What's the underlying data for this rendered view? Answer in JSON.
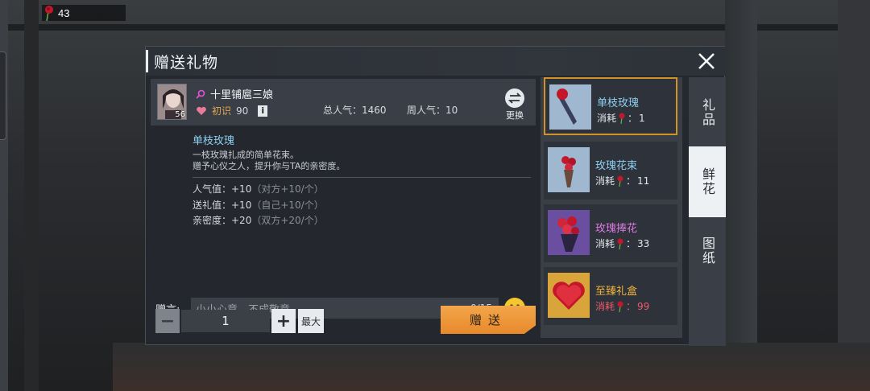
{
  "hud": {
    "rose_count": "43"
  },
  "dialog": {
    "title": "赠送礼物",
    "recipient": {
      "name": "十里铺扈三娘",
      "level": "56",
      "relation": "初识",
      "relation_value": "90",
      "info_label": "i",
      "total_popularity": "总人气：1460",
      "weekly_popularity": "周人气：10",
      "swap_label": "更换"
    },
    "gift_detail": {
      "name": "单枝玫瑰",
      "desc_line1": "一枝玫瑰扎成的简单花束。",
      "desc_line2": "赠予心仪之人，提升你与TA的亲密度。",
      "effects": [
        {
          "main": "人气值：+10",
          "sub": "（对方+10/个）"
        },
        {
          "main": "送礼值：+10",
          "sub": "（自己+10/个）"
        },
        {
          "main": "亲密度：+20",
          "sub": "（双方+20/个）"
        }
      ]
    },
    "message": {
      "label": "赠言:",
      "placeholder": "小小心意，不成敬意",
      "counter": "0/15"
    },
    "quantity": {
      "minus": "−",
      "value": "1",
      "plus": "+",
      "max_label": "最大"
    },
    "send_label": "赠送",
    "gifts": [
      {
        "name": "单枝玫瑰",
        "cost_label": "消耗",
        "cost": "1",
        "name_color": "#8fd0f0",
        "cost_color": "#e4e8ec",
        "selected": true
      },
      {
        "name": "玫瑰花束",
        "cost_label": "消耗",
        "cost": "11",
        "name_color": "#8fd0f0",
        "cost_color": "#e4e8ec",
        "selected": false
      },
      {
        "name": "玫瑰捧花",
        "cost_label": "消耗",
        "cost": "33",
        "name_color": "#e07ae6",
        "cost_color": "#e4e8ec",
        "selected": false
      },
      {
        "name": "至臻礼盒",
        "cost_label": "消耗",
        "cost": "99",
        "name_color": "#f0b43c",
        "cost_color": "#ef5b6b",
        "selected": false
      }
    ],
    "tabs": [
      {
        "label": "礼品",
        "active": false
      },
      {
        "label": "鲜花",
        "active": true
      },
      {
        "label": "图纸",
        "active": false
      }
    ]
  },
  "colors": {
    "accent_orange": "#e7892b",
    "selected_border": "#d1922a",
    "rose_red": "#c4182a"
  }
}
